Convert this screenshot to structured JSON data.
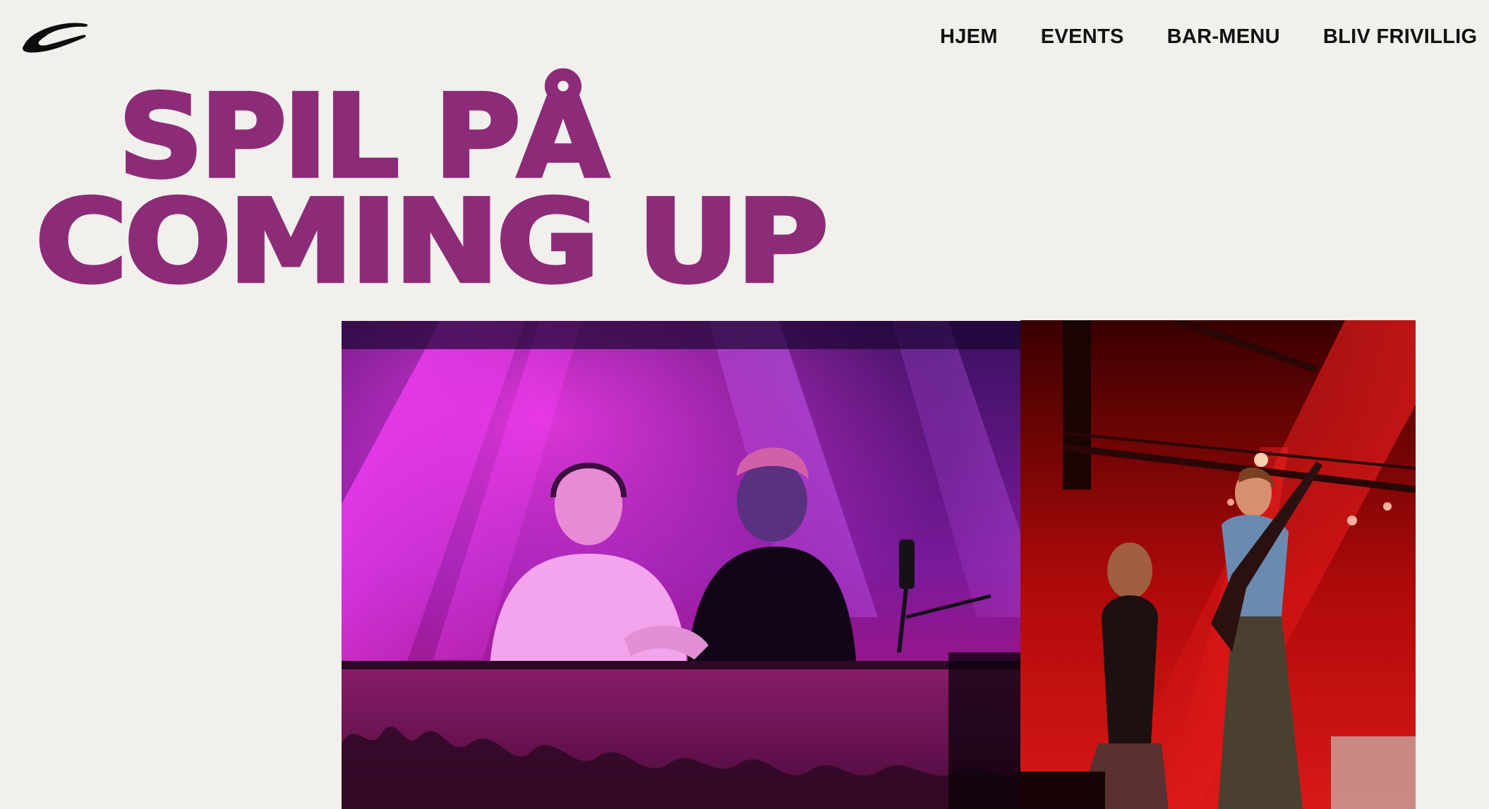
{
  "header": {
    "logo_icon": "coming-up-swoosh-logo",
    "nav": [
      {
        "label": "HJEM"
      },
      {
        "label": "EVENTS"
      },
      {
        "label": "BAR-MENU"
      },
      {
        "label": "BLIV FRIVILLIG"
      }
    ]
  },
  "hero": {
    "title_line_1": "SPIL PÅ",
    "title_line_2": "COMING UP",
    "title_color": "#8c2c78"
  },
  "gallery": {
    "images": [
      {
        "name": "dj-duo-photo",
        "alt": "Two DJs performing under pink and purple stage lights"
      },
      {
        "name": "band-photo",
        "alt": "Singer and guitarist performing under red stage lights"
      }
    ]
  },
  "colors": {
    "background": "#f1f0ec",
    "accent": "#8c2c78",
    "nav_text": "#111111"
  }
}
